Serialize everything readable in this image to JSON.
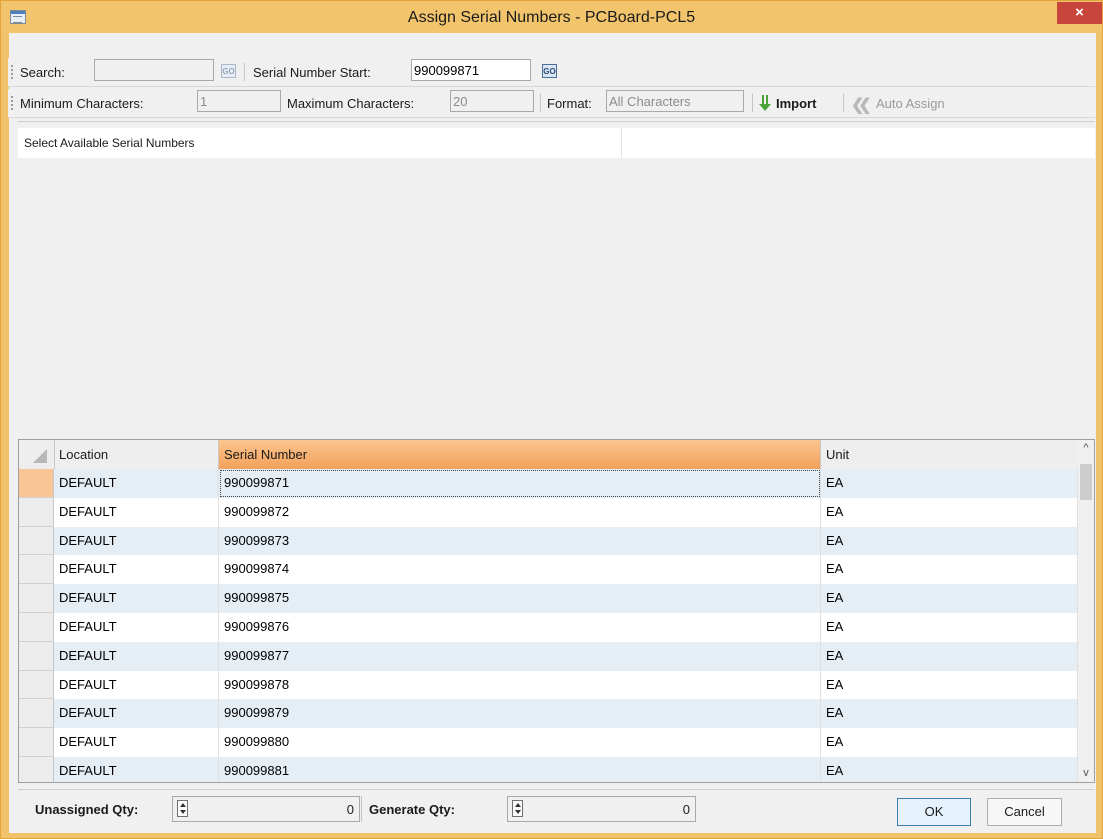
{
  "window": {
    "title": "Assign Serial Numbers - PCBoard-PCL5",
    "close_glyph": "×"
  },
  "toolbar1": {
    "search_label": "Search:",
    "search_value": "",
    "go_label": "GO",
    "serial_start_label": "Serial Number Start:",
    "serial_start_value": "990099871",
    "go2_label": "GO"
  },
  "toolbar2": {
    "min_label": "Minimum Characters:",
    "min_value": "1",
    "max_label": "Maximum Characters:",
    "max_value": "20",
    "format_label": "Format:",
    "format_value": "All Characters",
    "import_label": "Import",
    "auto_assign_label": "Auto Assign"
  },
  "available_panel": {
    "title": "Select Available Serial Numbers"
  },
  "grid": {
    "columns": [
      "Location",
      "Serial Number",
      "Unit"
    ],
    "sorted_column": "Serial Number",
    "rows": [
      {
        "location": "DEFAULT",
        "serial": "990099871",
        "unit": "EA"
      },
      {
        "location": "DEFAULT",
        "serial": "990099872",
        "unit": "EA"
      },
      {
        "location": "DEFAULT",
        "serial": "990099873",
        "unit": "EA"
      },
      {
        "location": "DEFAULT",
        "serial": "990099874",
        "unit": "EA"
      },
      {
        "location": "DEFAULT",
        "serial": "990099875",
        "unit": "EA"
      },
      {
        "location": "DEFAULT",
        "serial": "990099876",
        "unit": "EA"
      },
      {
        "location": "DEFAULT",
        "serial": "990099877",
        "unit": "EA"
      },
      {
        "location": "DEFAULT",
        "serial": "990099878",
        "unit": "EA"
      },
      {
        "location": "DEFAULT",
        "serial": "990099879",
        "unit": "EA"
      },
      {
        "location": "DEFAULT",
        "serial": "990099880",
        "unit": "EA"
      },
      {
        "location": "DEFAULT",
        "serial": "990099881",
        "unit": "EA"
      }
    ],
    "scroll_up_glyph": "^",
    "scroll_down_glyph": "v"
  },
  "footer": {
    "unassigned_label": "Unassigned Qty:",
    "unassigned_value": "0",
    "generate_label": "Generate Qty:",
    "generate_value": "0",
    "ok_label": "OK",
    "cancel_label": "Cancel"
  }
}
